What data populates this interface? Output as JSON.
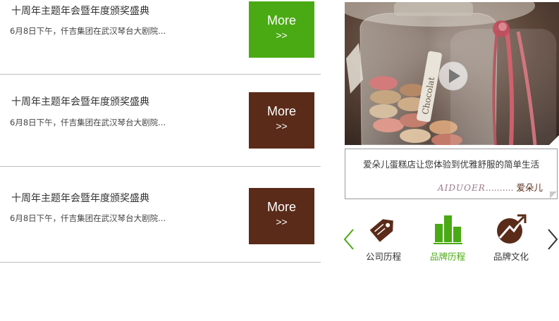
{
  "news": {
    "items": [
      {
        "title": "十周年主题年会暨年度颁奖盛典",
        "desc": "6月8日下午，仟吉集团在武汉琴台大剧院...",
        "more_label": "More",
        "more_arrows": ">>",
        "button_color": "#4aaa13"
      },
      {
        "title": "十周年主题年会暨年度颁奖盛典",
        "desc": "6月8日下午，仟吉集团在武汉琴台大剧院...",
        "more_label": "More",
        "more_arrows": ">>",
        "button_color": "#5a2b19"
      },
      {
        "title": "十周年主题年会暨年度颁奖盛典",
        "desc": "6月8日下午，仟吉集团在武汉琴台大剧院...",
        "more_label": "More",
        "more_arrows": ">>",
        "button_color": "#5a2b19"
      }
    ]
  },
  "video": {
    "jar_label": "Chocolat"
  },
  "caption": {
    "slogan": "爱朵儿蛋糕店让您体验到优雅舒服的简单生活",
    "brand_script": "AIDUOER",
    "brand_dots": "..........",
    "brand_name": "爱朵儿"
  },
  "carousel": {
    "items": [
      {
        "label": "公司历程",
        "icon": "price-tag-icon",
        "color": "#5a2b19",
        "active": false
      },
      {
        "label": "品牌历程",
        "icon": "bar-chart-icon",
        "color": "#4aaa13",
        "active": true
      },
      {
        "label": "品牌文化",
        "icon": "growth-arrow-icon",
        "color": "#5a2b19",
        "active": false
      }
    ]
  },
  "colors": {
    "accent_green": "#4aaa13",
    "brand_brown": "#5a2b19"
  }
}
